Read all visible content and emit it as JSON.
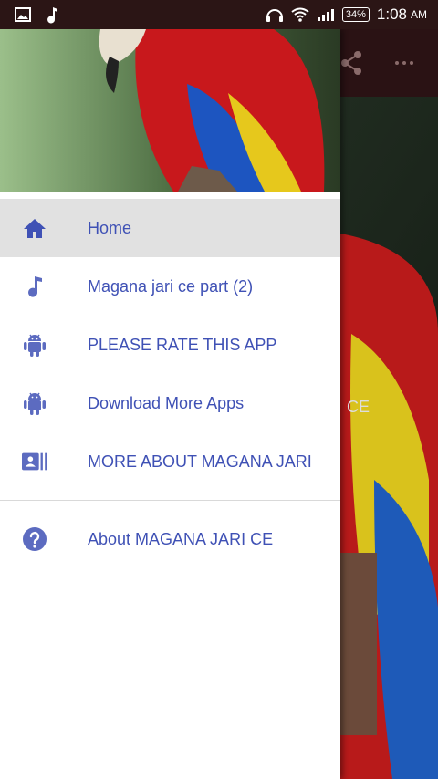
{
  "status_bar": {
    "battery": "34%",
    "time": "1:08",
    "ampm": "AM",
    "icons": [
      "image-icon",
      "music-note-icon",
      "headphones-icon",
      "wifi-icon",
      "signal-icon",
      "battery-icon"
    ]
  },
  "background_app": {
    "content_text": "CE"
  },
  "drawer": {
    "menu": [
      {
        "label": "Home",
        "icon": "home-icon",
        "selected": true
      },
      {
        "label": "Magana jari ce part (2)",
        "icon": "music-note-icon"
      },
      {
        "label": "PLEASE RATE THIS APP",
        "icon": "android-icon"
      },
      {
        "label": "Download More Apps",
        "icon": "android-icon"
      },
      {
        "label": "MORE ABOUT MAGANA JARI",
        "icon": "contact-card-icon"
      }
    ],
    "secondary": [
      {
        "label": "About MAGANA JARI CE",
        "icon": "help-circle-icon"
      }
    ]
  },
  "colors": {
    "accent": "#3f51b5",
    "icon": "#5c6bc0",
    "selected_bg": "#e1e1e1",
    "statusbar": "#2b1515"
  }
}
